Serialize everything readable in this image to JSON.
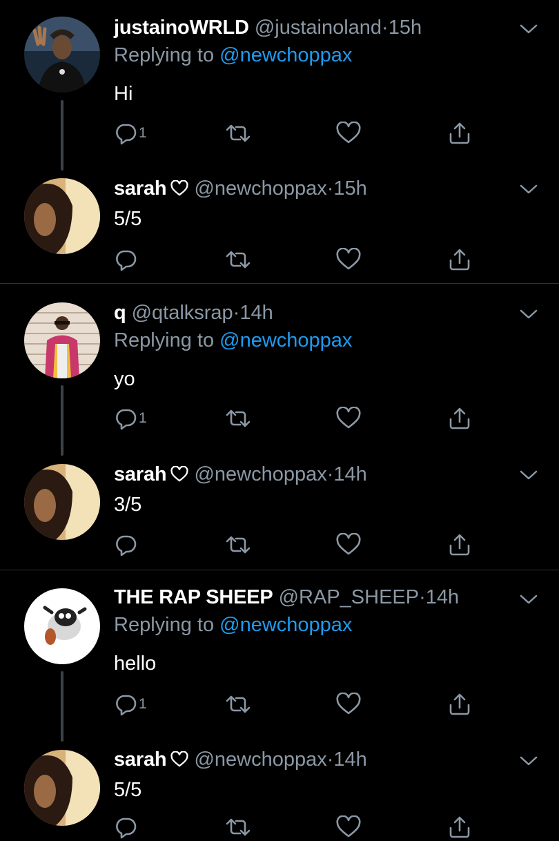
{
  "colors": {
    "background": "#000000",
    "text": "#ffffff",
    "muted": "#8b98a5",
    "link": "#1d9bf0",
    "divider": "#2f3336",
    "thread": "#3d4248"
  },
  "icons": {
    "reply": "reply-icon",
    "retweet": "retweet-icon",
    "like": "like-icon",
    "share": "share-icon",
    "more": "chevron-down-icon"
  },
  "tweets": [
    {
      "name": "justainoWRLD",
      "handle": "@justainoland",
      "dot": "·",
      "time": "15h",
      "reply_prefix": "Replying to ",
      "reply_to": "@newchoppax",
      "text": "Hi",
      "reply_count": "1"
    },
    {
      "name": "sarah",
      "handle": "@newchoppax",
      "dot": "·",
      "time": "15h",
      "text": "5/5",
      "reply_count": ""
    },
    {
      "name": "q",
      "handle": "@qtalksrap",
      "dot": "·",
      "time": "14h",
      "reply_prefix": "Replying to ",
      "reply_to": "@newchoppax",
      "text": "yo",
      "reply_count": "1"
    },
    {
      "name": "sarah",
      "handle": "@newchoppax",
      "dot": "·",
      "time": "14h",
      "text": "3/5",
      "reply_count": ""
    },
    {
      "name": "THE RAP SHEEP",
      "handle": "@RAP_SHEEP",
      "dot": "·",
      "time": "14h",
      "reply_prefix": "Replying to ",
      "reply_to": "@newchoppax",
      "text": "hello",
      "reply_count": "1"
    },
    {
      "name": "sarah",
      "handle": "@newchoppax",
      "dot": "·",
      "time": "14h",
      "text": "5/5",
      "reply_count": ""
    }
  ]
}
